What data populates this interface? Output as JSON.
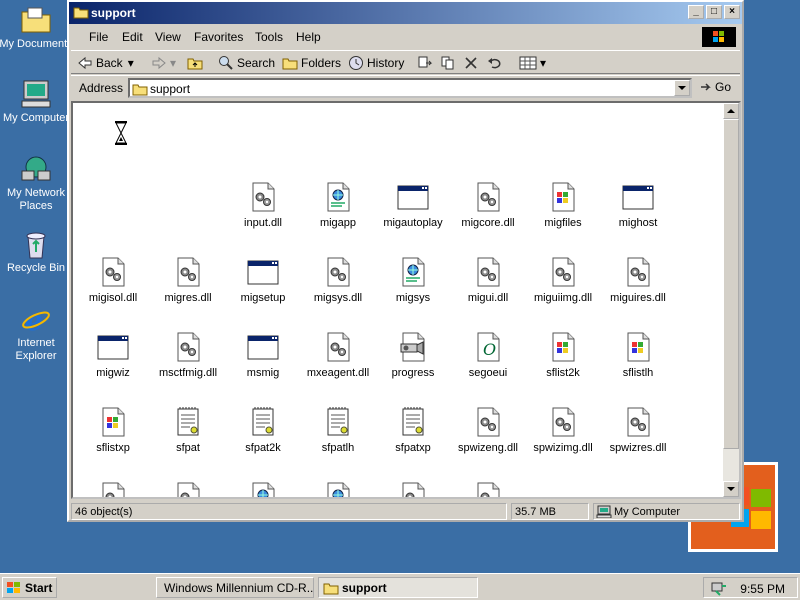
{
  "desktop": {
    "icons": [
      {
        "label": "My Documents"
      },
      {
        "label": "My Computer"
      },
      {
        "label": "My Network Places"
      },
      {
        "label": "Recycle Bin"
      },
      {
        "label": "Internet Explorer"
      }
    ]
  },
  "window": {
    "title": "support",
    "menu": [
      "File",
      "Edit",
      "View",
      "Favorites",
      "Tools",
      "Help"
    ],
    "toolbar": {
      "back": "Back",
      "search": "Search",
      "folders": "Folders",
      "history": "History"
    },
    "address": {
      "label": "Address",
      "value": "support",
      "go": "Go"
    },
    "files": [
      {
        "name": "input.dll",
        "icon": "dll-icon"
      },
      {
        "name": "migapp",
        "icon": "web-script-icon"
      },
      {
        "name": "migautoplay",
        "icon": "app-window-icon"
      },
      {
        "name": "migcore.dll",
        "icon": "dll-icon"
      },
      {
        "name": "migfiles",
        "icon": "windows-file-icon"
      },
      {
        "name": "mighost",
        "icon": "app-window-icon"
      },
      {
        "name": "migisol.dll",
        "icon": "dll-icon"
      },
      {
        "name": "migres.dll",
        "icon": "dll-icon"
      },
      {
        "name": "migsetup",
        "icon": "app-window-icon"
      },
      {
        "name": "migsys.dll",
        "icon": "dll-icon"
      },
      {
        "name": "migsys",
        "icon": "web-script-icon"
      },
      {
        "name": "migui.dll",
        "icon": "dll-icon"
      },
      {
        "name": "miguiimg.dll",
        "icon": "dll-icon"
      },
      {
        "name": "miguires.dll",
        "icon": "dll-icon"
      },
      {
        "name": "migwiz",
        "icon": "app-window-icon"
      },
      {
        "name": "msctfmig.dll",
        "icon": "dll-icon"
      },
      {
        "name": "msmig",
        "icon": "app-window-icon"
      },
      {
        "name": "mxeagent.dll",
        "icon": "dll-icon"
      },
      {
        "name": "progress",
        "icon": "media-file-icon"
      },
      {
        "name": "segoeui",
        "icon": "font-file-icon"
      },
      {
        "name": "sflist2k",
        "icon": "windows-file-icon"
      },
      {
        "name": "sflistlh",
        "icon": "windows-file-icon"
      },
      {
        "name": "sflistxp",
        "icon": "windows-file-icon"
      },
      {
        "name": "sfpat",
        "icon": "notepad-file-icon"
      },
      {
        "name": "sfpat2k",
        "icon": "notepad-file-icon"
      },
      {
        "name": "sfpatlh",
        "icon": "notepad-file-icon"
      },
      {
        "name": "sfpatxp",
        "icon": "notepad-file-icon"
      },
      {
        "name": "spwizeng.dll",
        "icon": "dll-icon"
      },
      {
        "name": "spwizimg.dll",
        "icon": "dll-icon"
      },
      {
        "name": "spwizres.dll",
        "icon": "dll-icon"
      },
      {
        "name": "",
        "icon": "dll-icon"
      },
      {
        "name": "",
        "icon": "dll-icon"
      },
      {
        "name": "",
        "icon": "web-script-icon"
      },
      {
        "name": "",
        "icon": "web-script-icon"
      },
      {
        "name": "",
        "icon": "dll-icon"
      },
      {
        "name": "",
        "icon": "dll-icon"
      }
    ],
    "status": {
      "objects": "46 object(s)",
      "size": "35.7 MB",
      "zone": "My Computer"
    }
  },
  "taskbar": {
    "start": "Start",
    "tasks": [
      {
        "label": "Windows Millennium CD-R..."
      },
      {
        "label": "support"
      }
    ],
    "clock": "9:55 PM"
  },
  "colors": {
    "desktop": "#3a6ea5",
    "titlebar_start": "#0a246a",
    "titlebar_end": "#a6caf0",
    "face": "#d4d0c8"
  }
}
